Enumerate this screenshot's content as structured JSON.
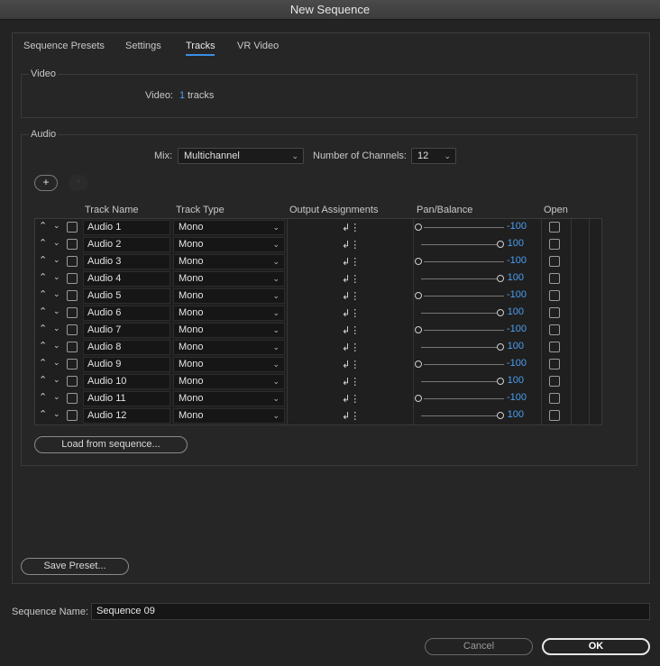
{
  "window": {
    "title": "New Sequence"
  },
  "tabs": [
    {
      "label": "Sequence Presets"
    },
    {
      "label": "Settings"
    },
    {
      "label": "Tracks",
      "active": true
    },
    {
      "label": "VR Video"
    }
  ],
  "video": {
    "group_label": "Video",
    "label": "Video:",
    "count": "1",
    "unit": "tracks"
  },
  "audio": {
    "group_label": "Audio",
    "mix_label": "Mix:",
    "mix_value": "Multichannel",
    "channels_label": "Number of Channels:",
    "channels_value": "12",
    "add_icon": "plus-icon",
    "remove_icon": "minus-icon"
  },
  "table": {
    "headers": {
      "track_name": "Track Name",
      "track_type": "Track Type",
      "output": "Output Assignments",
      "pan": "Pan/Balance",
      "open": "Open"
    },
    "rows": [
      {
        "name": "Audio 1",
        "type": "Mono",
        "pan": "-100",
        "pan_fraction": 0.0
      },
      {
        "name": "Audio 2",
        "type": "Mono",
        "pan": "100",
        "pan_fraction": 1.0
      },
      {
        "name": "Audio 3",
        "type": "Mono",
        "pan": "-100",
        "pan_fraction": 0.0
      },
      {
        "name": "Audio 4",
        "type": "Mono",
        "pan": "100",
        "pan_fraction": 1.0
      },
      {
        "name": "Audio 5",
        "type": "Mono",
        "pan": "-100",
        "pan_fraction": 0.0
      },
      {
        "name": "Audio 6",
        "type": "Mono",
        "pan": "100",
        "pan_fraction": 1.0
      },
      {
        "name": "Audio 7",
        "type": "Mono",
        "pan": "-100",
        "pan_fraction": 0.0
      },
      {
        "name": "Audio 8",
        "type": "Mono",
        "pan": "100",
        "pan_fraction": 1.0
      },
      {
        "name": "Audio 9",
        "type": "Mono",
        "pan": "-100",
        "pan_fraction": 0.0
      },
      {
        "name": "Audio 10",
        "type": "Mono",
        "pan": "100",
        "pan_fraction": 1.0
      },
      {
        "name": "Audio 11",
        "type": "Mono",
        "pan": "-100",
        "pan_fraction": 0.0
      },
      {
        "name": "Audio 12",
        "type": "Mono",
        "pan": "100",
        "pan_fraction": 1.0
      }
    ]
  },
  "buttons": {
    "load_from_sequence": "Load from sequence...",
    "save_preset": "Save Preset...",
    "cancel": "Cancel",
    "ok": "OK"
  },
  "sequence": {
    "label": "Sequence Name:",
    "value": "Sequence 09"
  },
  "colors": {
    "accent": "#4a9ff0",
    "background": "#232323"
  }
}
